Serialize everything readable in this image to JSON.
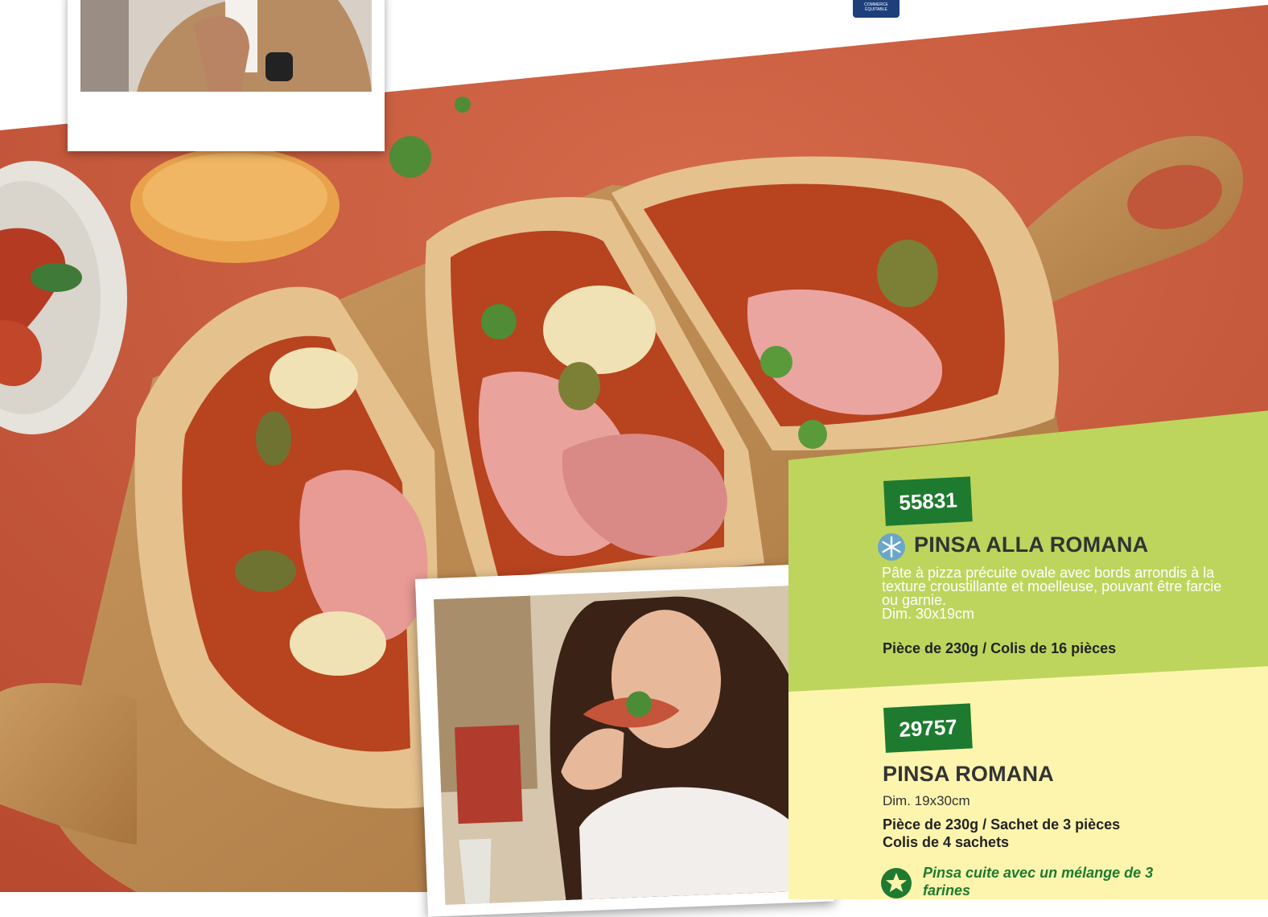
{
  "logo": {
    "line1": "COMMERCE",
    "line2": "ÉQUITABLE"
  },
  "products": [
    {
      "code": "55831",
      "icon": "snowflake-icon",
      "title": "PINSA ALLA ROMANA",
      "description": "Pâte à pizza précuite ovale avec bords arrondis à la texture croustillante et moelleuse, pouvant être farcie ou garnie.",
      "dimensions": "Dim. 30x19cm",
      "packaging": "Pièce de 230g / Colis de 16 pièces"
    },
    {
      "code": "29757",
      "title": "PINSA ROMANA",
      "dimensions": "Dim. 19x30cm",
      "packaging_line1": "Pièce de 230g / Sachet de 3 pièces",
      "packaging_line2": "Colis de 4 sachets",
      "note_icon": "star-icon",
      "note": "Pinsa cuite avec un mélange de 3 farines"
    }
  ],
  "colors": {
    "background_terracotta": "#c9573a",
    "panel_green": "#bdd55d",
    "panel_yellow": "#fdf5ad",
    "code_tag_green": "#1e7a2f",
    "title_gray": "#333333"
  }
}
